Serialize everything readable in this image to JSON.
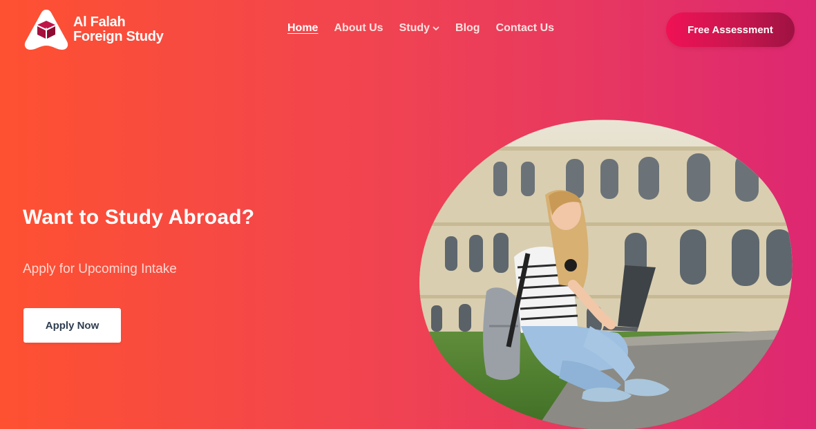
{
  "brand": {
    "line1": "Al Falah",
    "line2": "Foreign Study"
  },
  "nav": {
    "items": [
      {
        "label": "Home",
        "active": true
      },
      {
        "label": "About Us"
      },
      {
        "label": "Study",
        "dropdown": true
      },
      {
        "label": "Blog"
      },
      {
        "label": "Contact Us"
      }
    ]
  },
  "cta": {
    "label": "Free Assessment"
  },
  "hero": {
    "title": "Want to Study Abroad?",
    "subtitle": "Apply for Upcoming Intake",
    "button_label": "Apply Now"
  },
  "colors": {
    "gradient_start": "#fe5131",
    "gradient_end": "#dd2772",
    "cta_start": "#f01155",
    "cta_end": "#9e1242",
    "text_dark": "#2f3d4f"
  },
  "icons": {
    "logo": "graduation-cap-icon",
    "dropdown": "chevron-down-icon"
  }
}
